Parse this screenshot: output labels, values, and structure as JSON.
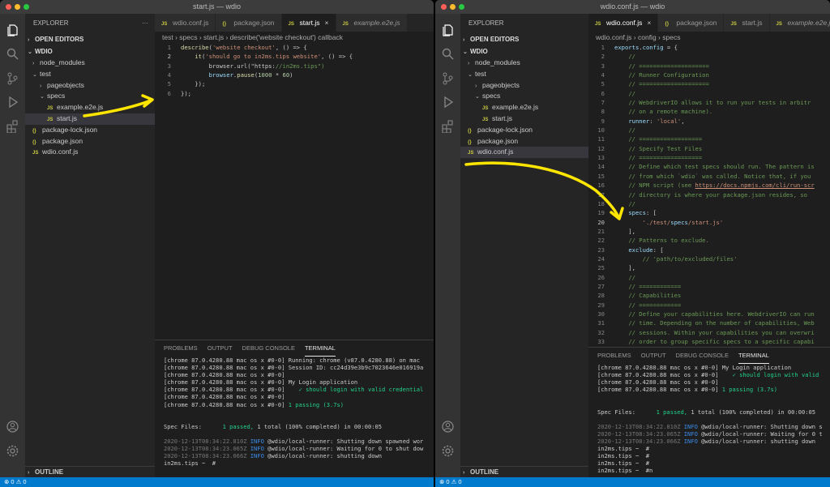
{
  "left": {
    "title": "start.js — wdio",
    "explorer_label": "EXPLORER",
    "open_editors": "OPEN EDITORS",
    "root": "WDIO",
    "tree": [
      {
        "label": "node_modules",
        "type": "folder",
        "collapsed": true
      },
      {
        "label": "test",
        "type": "folder"
      },
      {
        "label": "pageobjects",
        "type": "folder",
        "collapsed": true
      },
      {
        "label": "specs",
        "type": "folder"
      },
      {
        "label": "example.e2e.js",
        "type": "js"
      },
      {
        "label": "start.js",
        "type": "js"
      },
      {
        "label": "package-lock.json",
        "type": "json"
      },
      {
        "label": "package.json",
        "type": "json"
      },
      {
        "label": "wdio.conf.js",
        "type": "js"
      }
    ],
    "outline": "OUTLINE",
    "tabs": [
      "wdio.conf.js",
      "package.json",
      "start.js",
      "example.e2e.js"
    ],
    "breadcrumb": [
      "test",
      "specs",
      "start.js",
      "describe('website checkout') callback"
    ],
    "code_lines": [
      "describe('website checkout', () => {",
      "    it('should go to in2ms.tips website', () => {",
      "        browser.url(\"https://in2ms.tips\")",
      "        browser.pause(1000 * 60)",
      "    });",
      "});"
    ],
    "panel_tabs": [
      "PROBLEMS",
      "OUTPUT",
      "DEBUG CONSOLE",
      "TERMINAL"
    ],
    "terminal": [
      "[chrome 87.0.4280.88 mac os x #0-0] Running: chrome (v87.0.4280.88) on mac",
      "[chrome 87.0.4280.88 mac os x #0-0] Session ID: cc24d39e3b9c7023646e016919a",
      "[chrome 87.0.4280.88 mac os x #0-0]",
      "[chrome 87.0.4280.88 mac os x #0-0] My Login application",
      "[chrome 87.0.4280.88 mac os x #0-0]    ✓ should login with valid credential",
      "[chrome 87.0.4280.88 mac os x #0-0]",
      "[chrome 87.0.4280.88 mac os x #0-0] 1 passing (3.7s)",
      "",
      "",
      "Spec Files:      1 passed, 1 total (100% completed) in 00:00:05",
      "",
      "2020-12-13T08:34:22.810Z INFO @wdio/local-runner: Shutting down spawned wor",
      "2020-12-13T08:34:23.065Z INFO @wdio/local-runner: Waiting for 0 to shut dow",
      "2020-12-13T08:34:23.066Z INFO @wdio/local-runner: shutting down",
      "in2ms.tips ~  #"
    ],
    "status": "⊗ 0  ⚠ 0"
  },
  "right": {
    "title": "wdio.conf.js — wdio",
    "explorer_label": "EXPLORER",
    "open_editors": "OPEN EDITORS",
    "root": "WDIO",
    "tree": [
      {
        "label": "node_modules",
        "type": "folder",
        "collapsed": true
      },
      {
        "label": "test",
        "type": "folder"
      },
      {
        "label": "pageobjects",
        "type": "folder",
        "collapsed": true
      },
      {
        "label": "specs",
        "type": "folder"
      },
      {
        "label": "example.e2e.js",
        "type": "js"
      },
      {
        "label": "start.js",
        "type": "js"
      },
      {
        "label": "package-lock.json",
        "type": "json"
      },
      {
        "label": "package.json",
        "type": "json"
      },
      {
        "label": "wdio.conf.js",
        "type": "js"
      }
    ],
    "outline": "OUTLINE",
    "tabs": [
      "wdio.conf.js",
      "package.json",
      "start.js",
      "example.e2e.js"
    ],
    "breadcrumb": [
      "wdio.conf.js",
      "config",
      "specs"
    ],
    "code_lines": [
      "exports.config = {",
      "    //",
      "    // ====================",
      "    // Runner Configuration",
      "    // ====================",
      "    //",
      "    // WebdriverIO allows it to run your tests in arbitr",
      "    // on a remote machine).",
      "    runner: 'local',",
      "    //",
      "    // ==================",
      "    // Specify Test Files",
      "    // ==================",
      "    // Define which test specs should run. The pattern is",
      "    // from which `wdio` was called. Notice that, if you",
      "    // NPM script (see https://docs.npmjs.com/cli/run-scr",
      "    // directory is where your package.json resides, so",
      "    //",
      "    specs: [",
      "        './test/specs/start.js'",
      "    ],",
      "    // Patterns to exclude.",
      "    exclude: [",
      "        // 'path/to/excluded/files'",
      "    ],",
      "    //",
      "    // ============",
      "    // Capabilities",
      "    // ============",
      "    // Define your capabilities here. WebdriverIO can run",
      "    // time. Depending on the number of capabilities, Web",
      "    // sessions. Within your capabilities you can overwri",
      "    // order to group specific specs to a specific capabi"
    ],
    "panel_tabs": [
      "PROBLEMS",
      "OUTPUT",
      "DEBUG CONSOLE",
      "TERMINAL"
    ],
    "terminal": [
      "[chrome 87.0.4280.88 mac os x #0-0] My Login application",
      "[chrome 87.0.4280.88 mac os x #0-0]    ✓ should login with valid",
      "[chrome 87.0.4280.88 mac os x #0-0]",
      "[chrome 87.0.4280.88 mac os x #0-0] 1 passing (3.7s)",
      "",
      "",
      "Spec Files:      1 passed, 1 total (100% completed) in 00:00:05",
      "",
      "2020-12-13T08:34:22.810Z INFO @wdio/local-runner: Shutting down s",
      "2020-12-13T08:34:23.065Z INFO @wdio/local-runner: Waiting for 0 t",
      "2020-12-13T08:34:23.066Z INFO @wdio/local-runner: shutting down",
      "in2ms.tips ~  #",
      "in2ms.tips ~  #",
      "in2ms.tips ~  #",
      "in2ms.tips ~  #n"
    ],
    "status": "⊗ 0  ⚠ 0"
  },
  "colors": {
    "accent": "#007acc",
    "annotation": "#ffe600"
  }
}
